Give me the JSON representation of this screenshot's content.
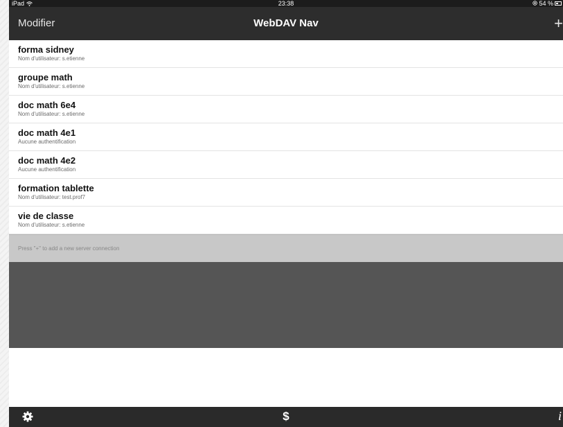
{
  "status_bar": {
    "device": "iPad",
    "time": "23:38",
    "battery": "54 %"
  },
  "nav_bar": {
    "left_label": "Modifier",
    "title": "WebDAV Nav",
    "add_icon": "+"
  },
  "servers": [
    {
      "title": "forma sidney",
      "subtitle": "Nom d'utilisateur: s.etienne"
    },
    {
      "title": "groupe math",
      "subtitle": "Nom d'utilisateur: s.etienne"
    },
    {
      "title": "doc math 6e4",
      "subtitle": "Nom d'utilisateur: s.etienne"
    },
    {
      "title": "doc math 4e1",
      "subtitle": "Aucune authentification"
    },
    {
      "title": "doc math 4e2",
      "subtitle": "Aucune authentification"
    },
    {
      "title": "formation tablette",
      "subtitle": "Nom d'utilisateur: test.prof7"
    },
    {
      "title": "vie de classe",
      "subtitle": "Nom d'utilisateur: s.etienne"
    }
  ],
  "hint": "Press \"+\" to add a new server connection",
  "toolbar": {
    "settings_icon": "gear-icon",
    "store_label": "$",
    "info_label": "i"
  }
}
